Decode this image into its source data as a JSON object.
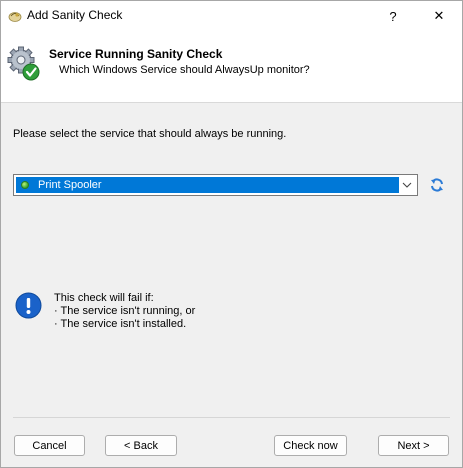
{
  "window": {
    "title": "Add Sanity Check",
    "help_label": "?",
    "close_label": "✕"
  },
  "header": {
    "title": "Service Running Sanity Check",
    "subtitle": "Which Windows Service should AlwaysUp monitor?"
  },
  "main": {
    "prompt": "Please select the service that should always be running.",
    "service_select": {
      "selected_value": "Print Spooler",
      "status": "running",
      "status_color": "#3aa72f"
    }
  },
  "info": {
    "heading": "This check will fail if:",
    "items": [
      "The service isn't running, or",
      "The service isn't installed."
    ]
  },
  "buttons": {
    "cancel": "Cancel",
    "back": "< Back",
    "check_now": "Check now",
    "next": "Next >"
  },
  "colors": {
    "accent": "#0078d7",
    "info_icon": "#1a62c9"
  }
}
